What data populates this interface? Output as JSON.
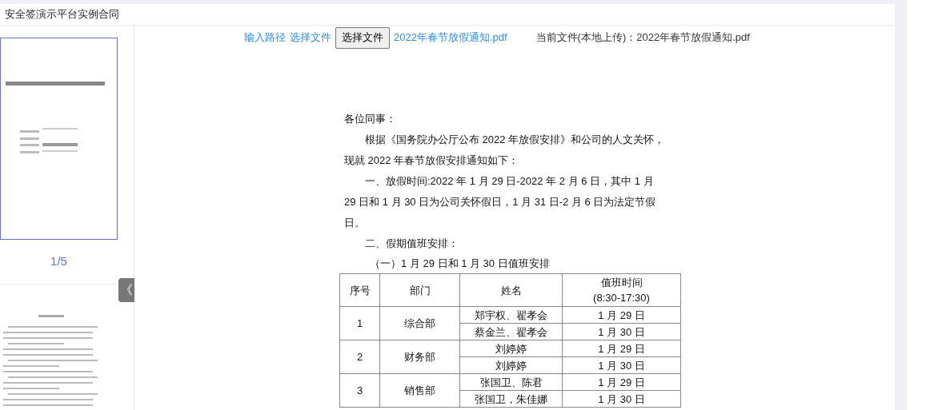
{
  "header": {
    "title": "安全签演示平台实例合同"
  },
  "toolbar": {
    "links": [
      "输入路径",
      "选择文件"
    ],
    "file_button": "选择文件",
    "file_name": "2022年春节放假通知.pdf",
    "current_file": "当前文件(本地上传)：2022年春节放假通知.pdf"
  },
  "sidebar": {
    "pages": [
      {
        "kind": "cover",
        "selected": true,
        "label": "1/5"
      },
      {
        "kind": "text",
        "selected": false
      }
    ],
    "collapse_icon": "《"
  },
  "document": {
    "paragraphs": [
      {
        "indent": false,
        "lines": [
          "各位同事："
        ]
      },
      {
        "indent": true,
        "lines": [
          "根据《国务院办公厅公布 2022 年放假安排》和公司的人文关怀，",
          "现就 2022 年春节放假安排通知如下："
        ]
      },
      {
        "indent": true,
        "lines": [
          "一、放假时间:2022 年 1 月 29 日-2022 年 2 月 6 日，其中 1 月",
          "29 日和 1 月 30 日为公司关怀假日，1 月 31 日-2 月 6 日为法定节假",
          "日。"
        ]
      },
      {
        "indent": true,
        "lines": [
          "二、假期值班安排："
        ]
      }
    ],
    "table_caption": "（一）1 月 29 日和 1 月 30 日值班安排",
    "table": {
      "columns": [
        "序号",
        "部门",
        "姓名",
        [
          "值班时间",
          "(8:30-17:30)"
        ]
      ],
      "groups": [
        {
          "no": "1",
          "dept": "综合部",
          "rows": [
            {
              "name": "郑宇权、翟孝会",
              "date": "1 月 29 日"
            },
            {
              "name": "蔡金兰、翟孝会",
              "date": "1 月 30 日"
            }
          ]
        },
        {
          "no": "2",
          "dept": "财务部",
          "rows": [
            {
              "name": "刘婷婷",
              "date": "1 月 29 日"
            },
            {
              "name": "刘婷婷",
              "date": "1 月 30 日"
            }
          ]
        },
        {
          "no": "3",
          "dept": "销售部",
          "rows": [
            {
              "name": "张国卫、陈君",
              "date": "1 月 29 日"
            },
            {
              "name": "张国卫，朱佳娜",
              "date": "1 月 30 日"
            }
          ]
        }
      ]
    }
  }
}
